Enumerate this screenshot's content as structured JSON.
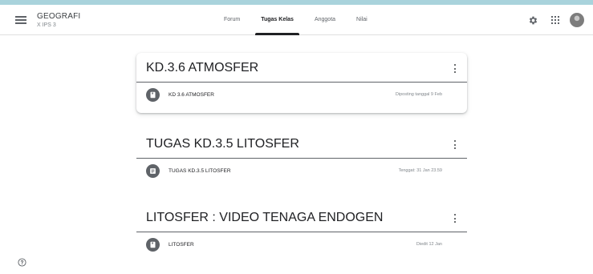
{
  "header": {
    "class_name": "GEOGRAFI",
    "class_section": "X IPS 3",
    "menu_icon": "hamburger-menu-icon",
    "settings_icon": "gear-icon",
    "apps_icon": "apps-grid-icon",
    "avatar_icon": "user-avatar"
  },
  "tabs": [
    {
      "label": "Forum",
      "active": false
    },
    {
      "label": "Tugas Kelas",
      "active": true
    },
    {
      "label": "Anggota",
      "active": false
    },
    {
      "label": "Nilai",
      "active": false
    }
  ],
  "topics": [
    {
      "title": "KD.3.6 ATMOSFER",
      "items": [
        {
          "icon": "material-icon",
          "label": "KD 3.6 ATMOSFER",
          "meta": "Diposting tanggal 9 Feb"
        }
      ]
    },
    {
      "title": "TUGAS KD.3.5 LITOSFER",
      "items": [
        {
          "icon": "assignment-icon",
          "label": "TUGAS KD.3.5 LITOSFER",
          "meta": "Tenggat: 31 Jan 23.59"
        }
      ]
    },
    {
      "title": "LITOSFER : VIDEO TENAGA ENDOGEN",
      "items": [
        {
          "icon": "material-icon",
          "label": "LITOSFER",
          "meta": "Diedit 12 Jan"
        }
      ]
    }
  ],
  "footer": {
    "help_icon": "help-icon"
  },
  "colors": {
    "accent_line": "#a9d3dc",
    "icon_circle": "#5f6368",
    "divider": "#5f6368"
  }
}
